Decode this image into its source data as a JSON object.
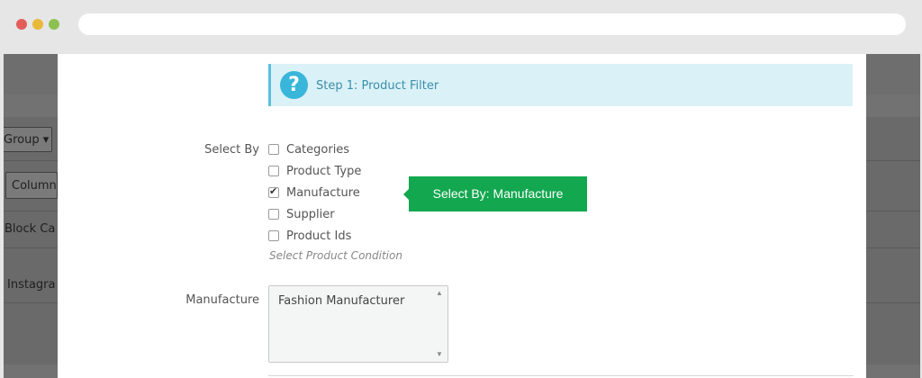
{
  "background": {
    "group_button": "Group ▾",
    "column_button": "Column",
    "row1_text": "Block Ca",
    "row2_text": "Instagra"
  },
  "step_panel": {
    "icon": "question-icon",
    "label": "Step 1: Product Filter"
  },
  "select_by": {
    "label": "Select By",
    "options": [
      {
        "label": "Categories",
        "checked": false
      },
      {
        "label": "Product Type",
        "checked": false
      },
      {
        "label": "Manufacture",
        "checked": true
      },
      {
        "label": "Supplier",
        "checked": false
      },
      {
        "label": "Product Ids",
        "checked": false
      }
    ],
    "help": "Select Product Condition"
  },
  "tooltip": {
    "text": "Select By: Manufacture",
    "color": "#13a74f"
  },
  "manufacture": {
    "label": "Manufacture",
    "items": [
      "Fashion Manufacturer"
    ]
  }
}
